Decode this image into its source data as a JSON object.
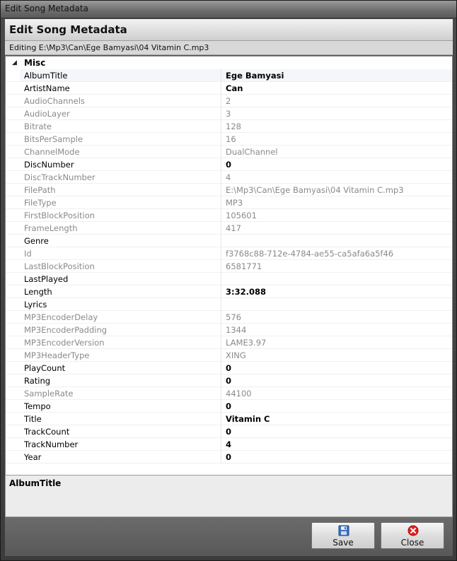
{
  "window": {
    "title": "Edit Song Metadata"
  },
  "header": {
    "title": "Edit Song Metadata"
  },
  "editing_line": "Editing E:\\Mp3\\Can\\Ege Bamyasi\\04 Vitamin C.mp3",
  "category": {
    "expand_glyph": "◢",
    "label": "Misc"
  },
  "properties": [
    {
      "name": "AlbumTitle",
      "value": "Ege Bamyasi",
      "editable": true
    },
    {
      "name": "ArtistName",
      "value": "Can",
      "editable": true
    },
    {
      "name": "AudioChannels",
      "value": "2",
      "editable": false
    },
    {
      "name": "AudioLayer",
      "value": "3",
      "editable": false
    },
    {
      "name": "Bitrate",
      "value": "128",
      "editable": false
    },
    {
      "name": "BitsPerSample",
      "value": "16",
      "editable": false
    },
    {
      "name": "ChannelMode",
      "value": "DualChannel",
      "editable": false
    },
    {
      "name": "DiscNumber",
      "value": "0",
      "editable": true
    },
    {
      "name": "DiscTrackNumber",
      "value": "4",
      "editable": false
    },
    {
      "name": "FilePath",
      "value": "E:\\Mp3\\Can\\Ege Bamyasi\\04 Vitamin C.mp3",
      "editable": false
    },
    {
      "name": "FileType",
      "value": "MP3",
      "editable": false
    },
    {
      "name": "FirstBlockPosition",
      "value": "105601",
      "editable": false
    },
    {
      "name": "FrameLength",
      "value": "417",
      "editable": false
    },
    {
      "name": "Genre",
      "value": "",
      "editable": true
    },
    {
      "name": "Id",
      "value": "f3768c88-712e-4784-ae55-ca5afa6a5f46",
      "editable": false
    },
    {
      "name": "LastBlockPosition",
      "value": "6581771",
      "editable": false
    },
    {
      "name": "LastPlayed",
      "value": "",
      "editable": true
    },
    {
      "name": "Length",
      "value": "3:32.088",
      "editable": true
    },
    {
      "name": "Lyrics",
      "value": "",
      "editable": true
    },
    {
      "name": "MP3EncoderDelay",
      "value": "576",
      "editable": false
    },
    {
      "name": "MP3EncoderPadding",
      "value": "1344",
      "editable": false
    },
    {
      "name": "MP3EncoderVersion",
      "value": "LAME3.97",
      "editable": false
    },
    {
      "name": "MP3HeaderType",
      "value": "XING",
      "editable": false
    },
    {
      "name": "PlayCount",
      "value": "0",
      "editable": true
    },
    {
      "name": "Rating",
      "value": "0",
      "editable": true
    },
    {
      "name": "SampleRate",
      "value": "44100",
      "editable": false
    },
    {
      "name": "Tempo",
      "value": "0",
      "editable": true
    },
    {
      "name": "Title",
      "value": "Vitamin C",
      "editable": true
    },
    {
      "name": "TrackCount",
      "value": "0",
      "editable": true
    },
    {
      "name": "TrackNumber",
      "value": "4",
      "editable": true
    },
    {
      "name": "Year",
      "value": "0",
      "editable": true
    }
  ],
  "selected_property": "AlbumTitle",
  "description": {
    "title": "AlbumTitle"
  },
  "buttons": {
    "save": {
      "label": "Save",
      "icon": "floppy-disk-icon",
      "icon_color": "#3a6fc4"
    },
    "close": {
      "label": "Close",
      "icon": "close-icon",
      "icon_color": "#e02020"
    }
  }
}
